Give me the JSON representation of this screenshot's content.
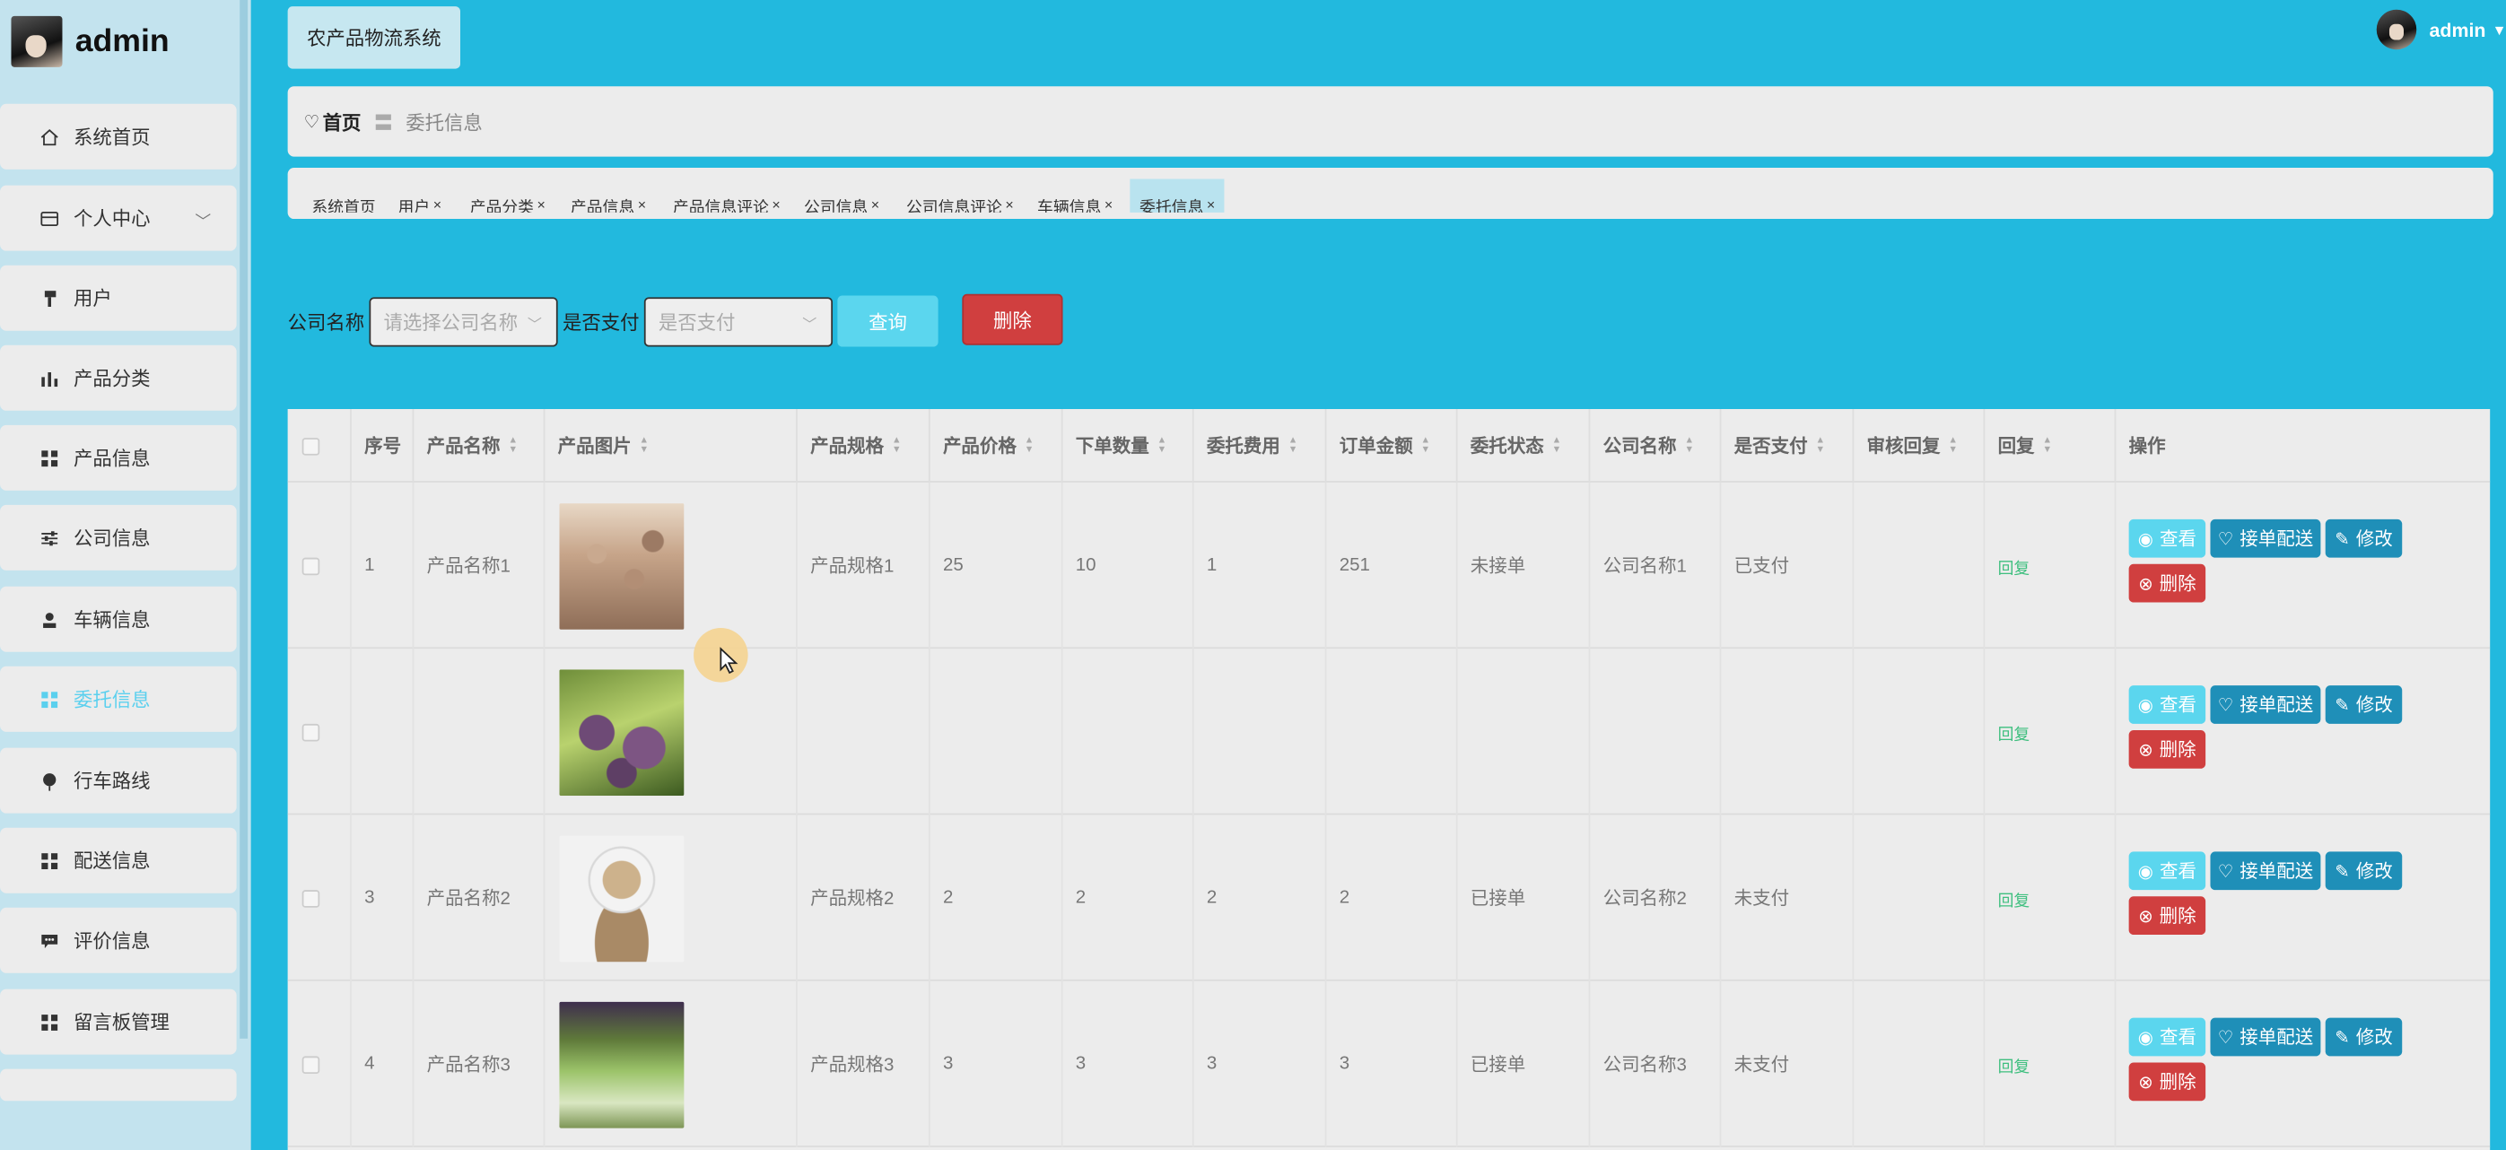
{
  "sidebar": {
    "brand": "admin",
    "items": [
      {
        "label": "系统首页",
        "icon": "home-icon"
      },
      {
        "label": "个人中心",
        "icon": "card-icon",
        "expandable": true
      },
      {
        "label": "用户",
        "icon": "user-icon"
      },
      {
        "label": "产品分类",
        "icon": "bar-chart-icon"
      },
      {
        "label": "产品信息",
        "icon": "grid-icon"
      },
      {
        "label": "公司信息",
        "icon": "sliders-icon"
      },
      {
        "label": "车辆信息",
        "icon": "person-icon"
      },
      {
        "label": "委托信息",
        "icon": "grid-icon",
        "active": true
      },
      {
        "label": "行车路线",
        "icon": "pin-icon"
      },
      {
        "label": "配送信息",
        "icon": "grid-icon"
      },
      {
        "label": "评价信息",
        "icon": "chat-icon"
      },
      {
        "label": "留言板管理",
        "icon": "grid-icon"
      }
    ]
  },
  "header": {
    "system_button": "农产品物流系统",
    "user_name": "admin"
  },
  "breadcrumb": {
    "home": "首页",
    "separator": "〓",
    "current": "委托信息"
  },
  "tags": [
    {
      "label": "系统首页",
      "closable": false
    },
    {
      "label": "用户",
      "closable": true
    },
    {
      "label": "产品分类",
      "closable": true
    },
    {
      "label": "产品信息",
      "closable": true
    },
    {
      "label": "产品信息评论",
      "closable": true
    },
    {
      "label": "公司信息",
      "closable": true
    },
    {
      "label": "公司信息评论",
      "closable": true
    },
    {
      "label": "车辆信息",
      "closable": true
    },
    {
      "label": "委托信息",
      "closable": true,
      "active": true
    }
  ],
  "search": {
    "company_label": "公司名称",
    "company_placeholder": "请选择公司名称",
    "paid_label": "是否支付",
    "paid_placeholder": "是否支付",
    "query_button": "查询",
    "delete_button": "删除"
  },
  "table": {
    "columns": [
      "序号",
      "产品名称",
      "产品图片",
      "产品规格",
      "产品价格",
      "下单数量",
      "委托费用",
      "订单金额",
      "委托状态",
      "公司名称",
      "是否支付",
      "审核回复",
      "回复",
      "操作"
    ],
    "rows": [
      {
        "index": "1",
        "name": "产品名称1",
        "spec": "产品规格1",
        "price": "25",
        "qty": "10",
        "fee": "1",
        "amount": "251",
        "status": "未接单",
        "company": "公司名称1",
        "paid": "已支付",
        "review": "",
        "reply": "回复"
      },
      {
        "index": "",
        "name": "",
        "spec": "",
        "price": "",
        "qty": "",
        "fee": "",
        "amount": "",
        "status": "",
        "company": "",
        "paid": "",
        "review": "",
        "reply": "回复"
      },
      {
        "index": "3",
        "name": "产品名称2",
        "spec": "产品规格2",
        "price": "2",
        "qty": "2",
        "fee": "2",
        "amount": "2",
        "status": "已接单",
        "company": "公司名称2",
        "paid": "未支付",
        "review": "",
        "reply": "回复"
      },
      {
        "index": "4",
        "name": "产品名称3",
        "spec": "产品规格3",
        "price": "3",
        "qty": "3",
        "fee": "3",
        "amount": "3",
        "status": "已接单",
        "company": "公司名称3",
        "paid": "未支付",
        "review": "",
        "reply": "回复"
      }
    ],
    "actions": {
      "view": "查看",
      "send": "接单配送",
      "edit": "修改",
      "delete": "删除"
    }
  },
  "colors": {
    "background": "#22b9de",
    "sidebar": "#c3e3ee",
    "active_menu": "#5bd0ee",
    "danger": "#d03f3f",
    "primary": "#1f8fb8",
    "info": "#5bd6ee",
    "reply": "#3fbf7f"
  }
}
